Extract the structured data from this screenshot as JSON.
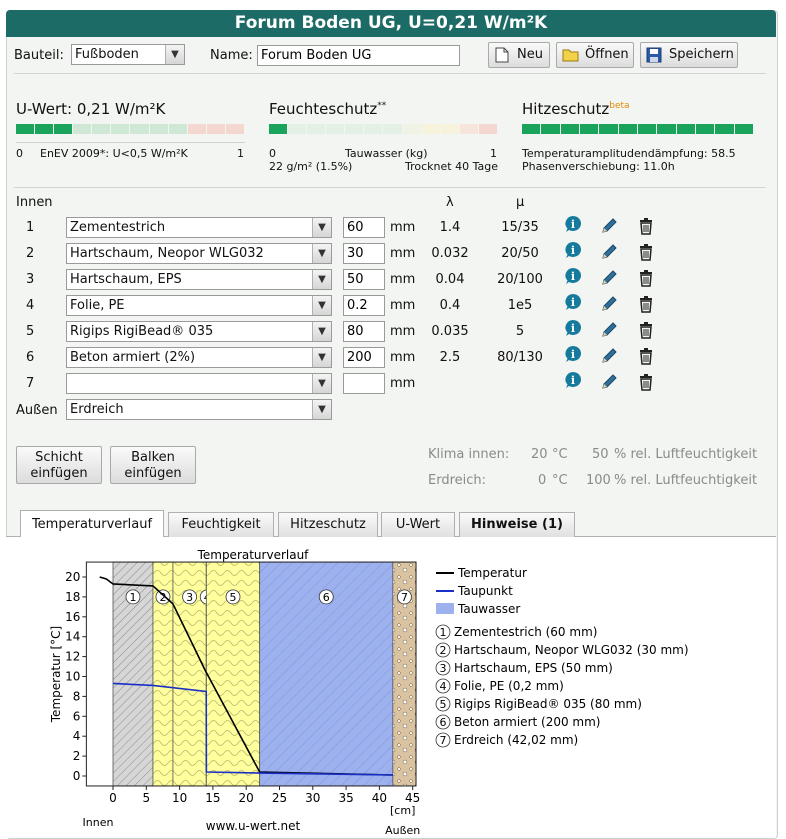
{
  "window": {
    "title": "Forum Boden UG, U=0,21 W/m²K"
  },
  "toolbar": {
    "bauteil_label": "Bauteil:",
    "bauteil_value": "Fußboden",
    "name_label": "Name:",
    "name_value": "Forum Boden UG",
    "new_label": "Neu",
    "open_label": "Öffnen",
    "save_label": "Speichern"
  },
  "summary": {
    "uwert": {
      "title": "U-Wert: 0,21 W/m²K",
      "scale_left": "0",
      "scale_mid": "EnEV 2009*: U<0,5 W/m²K",
      "scale_right": "1",
      "level": 0.21
    },
    "feuchte": {
      "title": "Feuchteschutz",
      "sup": "**",
      "scale_left": "0",
      "scale_mid": "Tauwasser (kg)",
      "scale_right": "1",
      "detail_left": "22 g/m² (1.5%)",
      "detail_right": "Trocknet 40 Tage",
      "level": 0.02
    },
    "hitze": {
      "title": "Hitzeschutz",
      "sup": "beta",
      "line1": "Temperaturamplitudendämpfung: 58.5",
      "line2": "Phasenverschiebung: 11.0h",
      "level": 1.0
    }
  },
  "layers": {
    "innen_label": "Innen",
    "aussen_label": "Außen",
    "lambda_header": "λ",
    "mu_header": "μ",
    "unit": "mm",
    "rows": [
      {
        "num": "1",
        "material": "Zementestrich",
        "thickness": "60",
        "lambda": "1.4",
        "mu": "15/35"
      },
      {
        "num": "2",
        "material": "Hartschaum, Neopor WLG032",
        "thickness": "30",
        "lambda": "0.032",
        "mu": "20/50"
      },
      {
        "num": "3",
        "material": "Hartschaum, EPS",
        "thickness": "50",
        "lambda": "0.04",
        "mu": "20/100"
      },
      {
        "num": "4",
        "material": "Folie, PE",
        "thickness": "0.2",
        "lambda": "0.4",
        "mu": "1e5"
      },
      {
        "num": "5",
        "material": "Rigips RigiBead® 035",
        "thickness": "80",
        "lambda": "0.035",
        "mu": "5"
      },
      {
        "num": "6",
        "material": "Beton armiert (2%)",
        "thickness": "200",
        "lambda": "2.5",
        "mu": "80/130"
      },
      {
        "num": "7",
        "material": "",
        "thickness": "",
        "lambda": "",
        "mu": ""
      }
    ],
    "aussen_value": "Erdreich"
  },
  "actions": {
    "schicht_line1": "Schicht",
    "schicht_line2": "einfügen",
    "balken_line1": "Balken",
    "balken_line2": "einfügen"
  },
  "klima": {
    "innen_label": "Klima innen:",
    "innen_temp": "20",
    "innen_unit": "°C",
    "innen_rh": "50",
    "innen_rh_label": "% rel. Luftfeuchtigkeit",
    "erd_label": "Erdreich:",
    "erd_temp": "0",
    "erd_unit": "°C",
    "erd_rh": "100",
    "erd_rh_label": "% rel. Luftfeuchtigkeit"
  },
  "tabs": [
    {
      "label": "Temperaturverlauf",
      "active": true
    },
    {
      "label": "Feuchtigkeit",
      "active": false
    },
    {
      "label": "Hitzeschutz",
      "active": false
    },
    {
      "label": "U-Wert",
      "active": false
    },
    {
      "label": "Hinweise (1)",
      "active": false
    }
  ],
  "colors": {
    "accent": "#1d6b66",
    "gauge_green": "#1aa35a",
    "taupunkt": "#1a2fc4",
    "tauwasser": "#9db1ef",
    "insulation": "#ffff9e"
  },
  "chart_data": {
    "type": "line",
    "title": "Temperaturverlauf",
    "xlabel": "[cm]",
    "ylabel": "Temperatur [°C]",
    "x_ticks": [
      "0",
      "5",
      "10",
      "15",
      "20",
      "25",
      "30",
      "35",
      "40",
      "45"
    ],
    "y_ticks": [
      "0",
      "2",
      "4",
      "6",
      "8",
      "10",
      "12",
      "14",
      "16",
      "18",
      "20"
    ],
    "xlim": [
      -4,
      45
    ],
    "ylim": [
      -1,
      21
    ],
    "x_left_label": "Innen",
    "x_right_label": "Außen",
    "footer": "www.u-wert.net",
    "layers": [
      {
        "num": "1",
        "start": 0,
        "end": 6,
        "legend": "Zementestrich (60 mm)",
        "fill": "#d6d6d6"
      },
      {
        "num": "2",
        "start": 6,
        "end": 9,
        "legend": "Hartschaum, Neopor WLG032 (30 mm)",
        "fill": "#ffff9e"
      },
      {
        "num": "3",
        "start": 9,
        "end": 14,
        "legend": "Hartschaum, EPS (50 mm)",
        "fill": "#ffff9e"
      },
      {
        "num": "4",
        "start": 14,
        "end": 14.02,
        "legend": "Folie, PE (0,2 mm)",
        "fill": "#000000"
      },
      {
        "num": "5",
        "start": 14.02,
        "end": 22.02,
        "legend": "Rigips RigiBead® 035 (80 mm)",
        "fill": "#ffff9e"
      },
      {
        "num": "6",
        "start": 22.02,
        "end": 42.02,
        "legend": "Beton armiert (200 mm)",
        "fill": "#9db1ef"
      },
      {
        "num": "7",
        "start": 42.02,
        "end": 45.5,
        "legend": "Erdreich (42,02 mm)",
        "fill": "#d9c3a0"
      }
    ],
    "series": [
      {
        "name": "Temperatur",
        "color": "#000000",
        "x": [
          -2,
          -1,
          0,
          6,
          9,
          14,
          14.02,
          22.02,
          42.02
        ],
        "y": [
          20,
          19.8,
          19.3,
          19.1,
          17.3,
          10.4,
          10.4,
          0.4,
          0.1
        ]
      },
      {
        "name": "Taupunkt",
        "color": "#1a2fc4",
        "x": [
          0,
          6,
          14,
          14.02,
          22.02,
          42.02
        ],
        "y": [
          9.3,
          9.1,
          8.5,
          0.4,
          0.3,
          0.1
        ]
      }
    ],
    "legend_extra": "Tauwasser"
  }
}
